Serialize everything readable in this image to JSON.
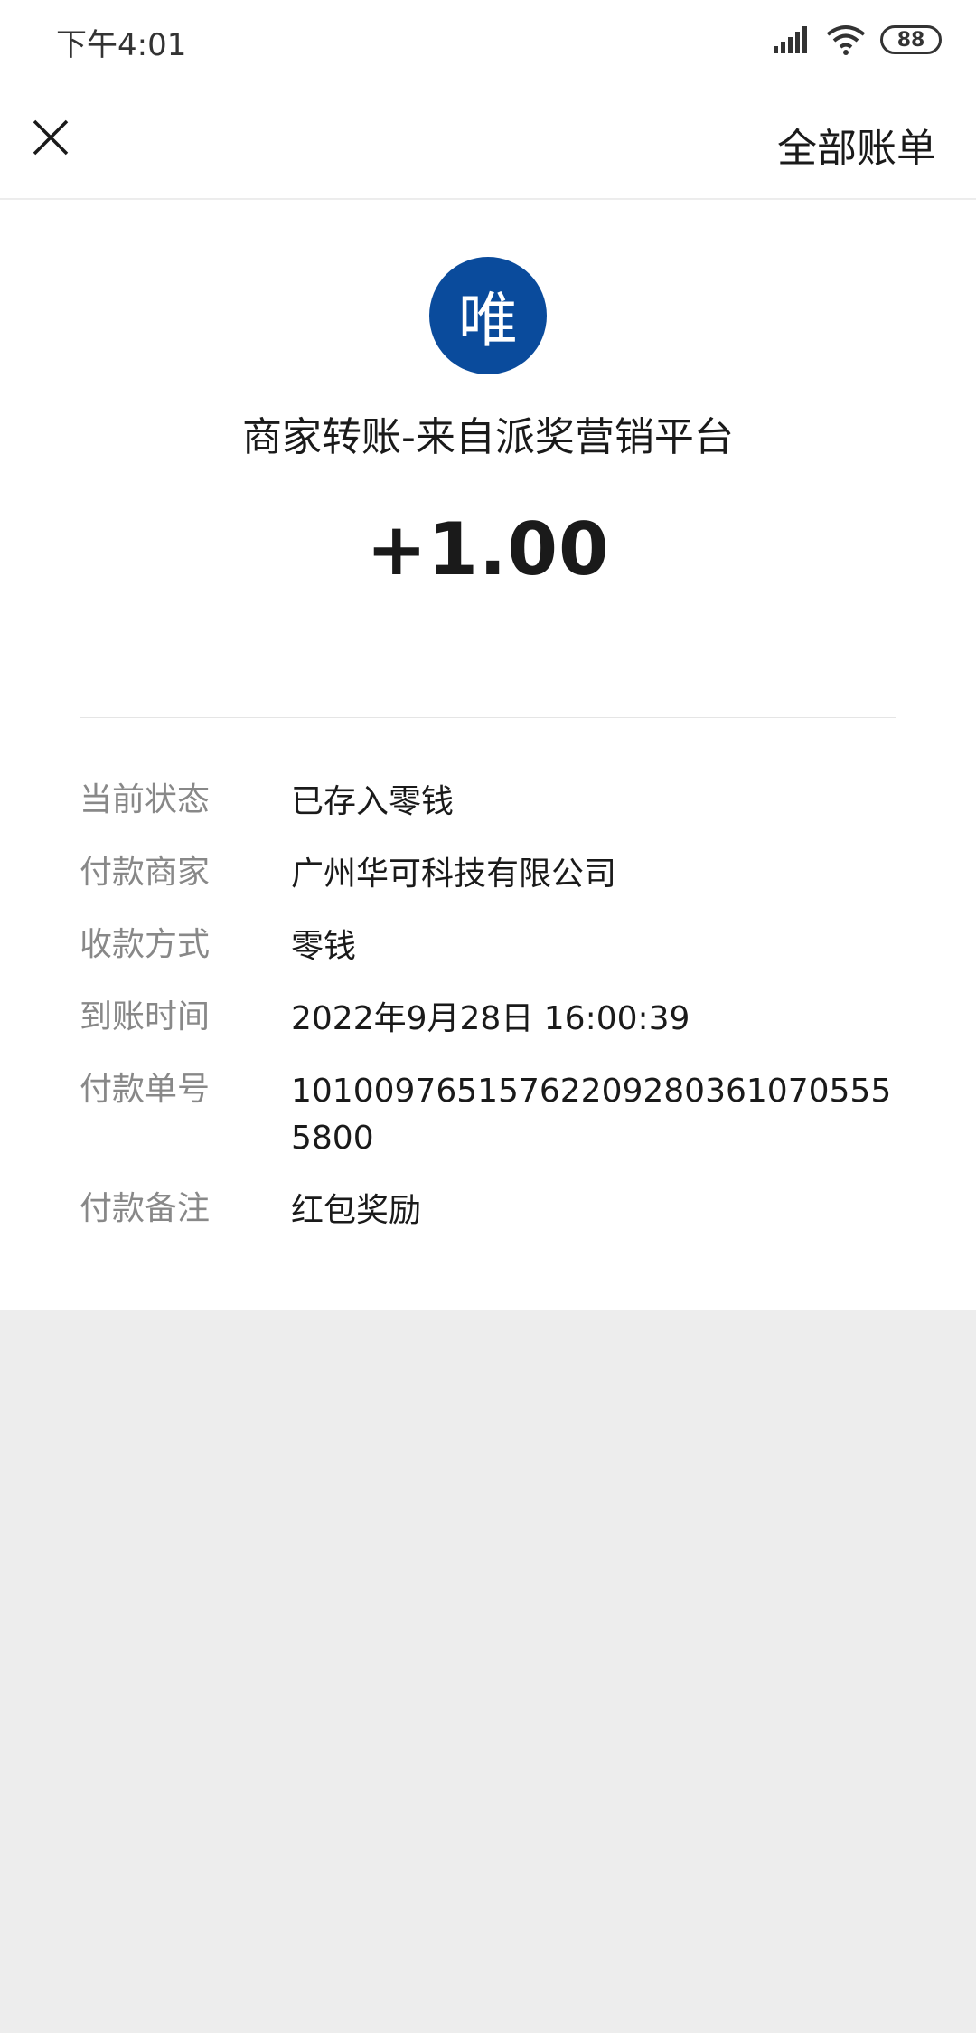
{
  "status_bar": {
    "time": "下午4:01",
    "battery": "88"
  },
  "nav": {
    "all_bills_label": "全部账单"
  },
  "payee": {
    "avatar_char": "唯",
    "avatar_color": "#0a4b9c",
    "title": "商家转账-来自派奖营销平台"
  },
  "amount": "+1.00",
  "details": [
    {
      "label": "当前状态",
      "value": "已存入零钱"
    },
    {
      "label": "付款商家",
      "value": "广州华可科技有限公司"
    },
    {
      "label": "收款方式",
      "value": "零钱"
    },
    {
      "label": "到账时间",
      "value": "2022年9月28日 16:00:39"
    },
    {
      "label": "付款单号",
      "value": "101009765157622092803610705555800"
    },
    {
      "label": "付款备注",
      "value": "红包奖励"
    }
  ]
}
